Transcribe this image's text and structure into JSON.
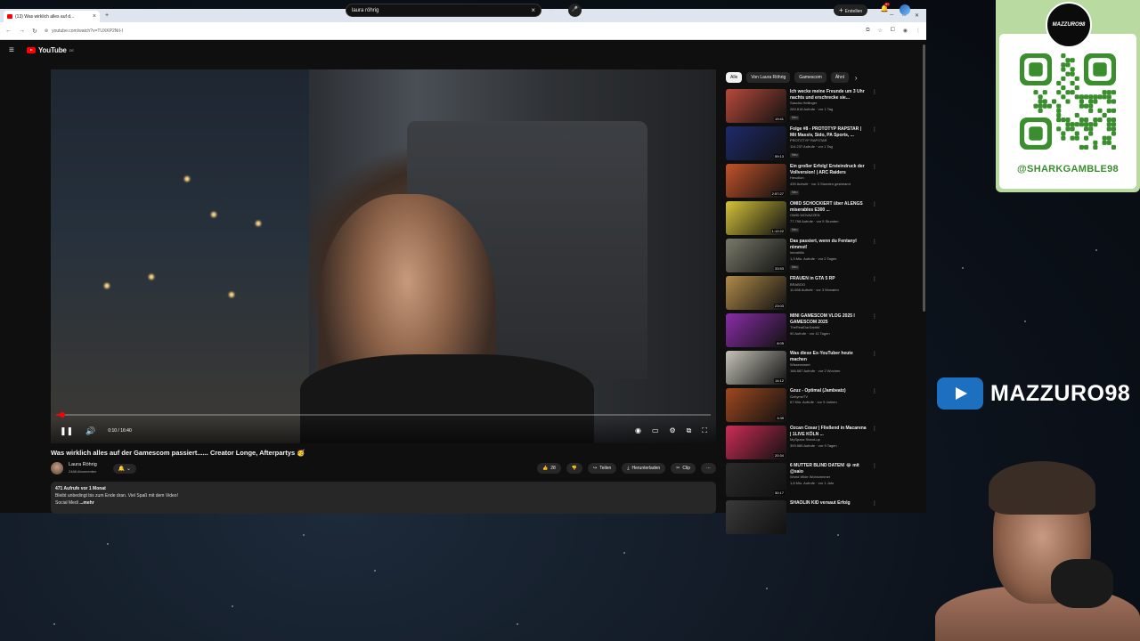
{
  "browser": {
    "tab_title": "(13) Was wirklich alles auf d...",
    "url": "youtube.com/watch?v=TUXKP2NiI-I"
  },
  "youtube": {
    "logo_text": "YouTube",
    "logo_region": "DE",
    "search_query": "laura röhrig",
    "create_label": "Erstellen",
    "notification_count": "9+"
  },
  "player": {
    "current_time": "0:10 / 16:40",
    "progress_fraction": 0.01
  },
  "video": {
    "title": "Was wirklich alles auf der Gamescom passiert...... Creator Longe, Afterpartys 🥳",
    "channel": "Laura Röhrig",
    "subscribers": "2468 Abonnenten",
    "likes": "28",
    "share_label": "Teilen",
    "download_label": "Herunterladen",
    "clip_label": "Clip",
    "description": {
      "stats": "471 Aufrufe  vor 1 Monat",
      "line1": "Bleibt unbedingt bis zum Ende dran. Viel Spaß mit dem Video!",
      "line2": "Social Medi",
      "more": "...mehr"
    }
  },
  "chips": [
    "Alle",
    "Von Laura Röhrig",
    "Gamescom",
    "Ähnl"
  ],
  "recommendations": [
    {
      "title": "Ich wecke meine Freunde um 3 Uhr nachts und erschrecke sie...",
      "channel": "Sascha Heilinger",
      "stats": "283.818 Aufrufe · vor 1 Tag",
      "badge": "Neu",
      "duration": "19:41",
      "color": "#b84a3b"
    },
    {
      "title": "Folge #8 - PROTOTYP RAPSTAR | Mit Massiv, Sido, PA Sports, ...",
      "channel": "PROTOTYP RAPSTAR",
      "stats": "114.237 Aufrufe · vor 1 Tag",
      "badge": "Neu",
      "duration": "59:13",
      "color": "#1f2a6b"
    },
    {
      "title": "Ein großer Erfolg! Ersteindruck der Vollversion! | ARC Raiders",
      "channel": "Hevollon",
      "stats": "439 Aufrufe · vor 3 Stunden gestreamt",
      "badge": "Neu",
      "duration": "2:57:27",
      "color": "#c2532a"
    },
    {
      "title": "OMID SCHOCKIERT über ALENGS miserables E300 ...",
      "channel": "OMID MOVAZZEN",
      "stats": "77.798 Aufrufe · vor 5 Stunden",
      "badge": "Neu",
      "duration": "1:12:22",
      "color": "#d4c23a"
    },
    {
      "title": "Das passiert, wenn du Fentanyl nimmst!",
      "channel": "inmatrikk",
      "stats": "1,3 Mio. Aufrufe · vor 2 Tagen",
      "badge": "Neu",
      "duration": "33:53",
      "color": "#7a7a6a"
    },
    {
      "title": "FRAUEN in GTA 5 RP",
      "channel": "BRABOO",
      "stats": "11.656 Aufrufe · vor 3 Monaten",
      "badge": "",
      "duration": "23:03",
      "color": "#b08a4a"
    },
    {
      "title": "MINI GAMESCOM VLOG 2025 I GAMESCOM 2025",
      "channel": "TheRealDarDaddd",
      "stats": "90 Aufrufe · vor 11 Tagen",
      "badge": "",
      "duration": "8:05",
      "color": "#8a2da8"
    },
    {
      "title": "Was diese Ex-YouTuber heute machen",
      "channel": "Wissenswert",
      "stats": "166.587 Aufrufe · vor 2 Wochen",
      "badge": "",
      "duration": "14:12",
      "color": "#c5c3b8"
    },
    {
      "title": "Gzuz - Optimal (Jambeatz)",
      "channel": "GzhymeTV",
      "stats": "67 Mio. Aufrufe · vor 9 Jahren",
      "badge": "",
      "duration": "3:39",
      "color": "#a0481f"
    },
    {
      "title": "Özcan Cosar | Fließend in Macarena | 1LIVE KÖLN ...",
      "channel": "MySpass Stand-up",
      "stats": "393.985 Aufrufe · vor 9 Tagen",
      "badge": "",
      "duration": "20:34",
      "color": "#cc2d55"
    },
    {
      "title": "6 MÜTTER BLIND DATEN! 😂 mit @saio",
      "channel": "World Wide Wohnzimmer",
      "stats": "1,8 Mio. Aufrufe · vor 1 Jahr",
      "badge": "",
      "duration": "30:17",
      "color": "#2a2a2a"
    },
    {
      "title": "SHAOLIN KID versaut Erfolg",
      "channel": "",
      "stats": "",
      "badge": "",
      "duration": "",
      "color": "#3a3a3a"
    }
  ],
  "overlay": {
    "qr_logo_text": "MAZZURO98",
    "qr_handle": "@SHARKGAMBLE98",
    "channel_badge": "MAZZURO98"
  }
}
